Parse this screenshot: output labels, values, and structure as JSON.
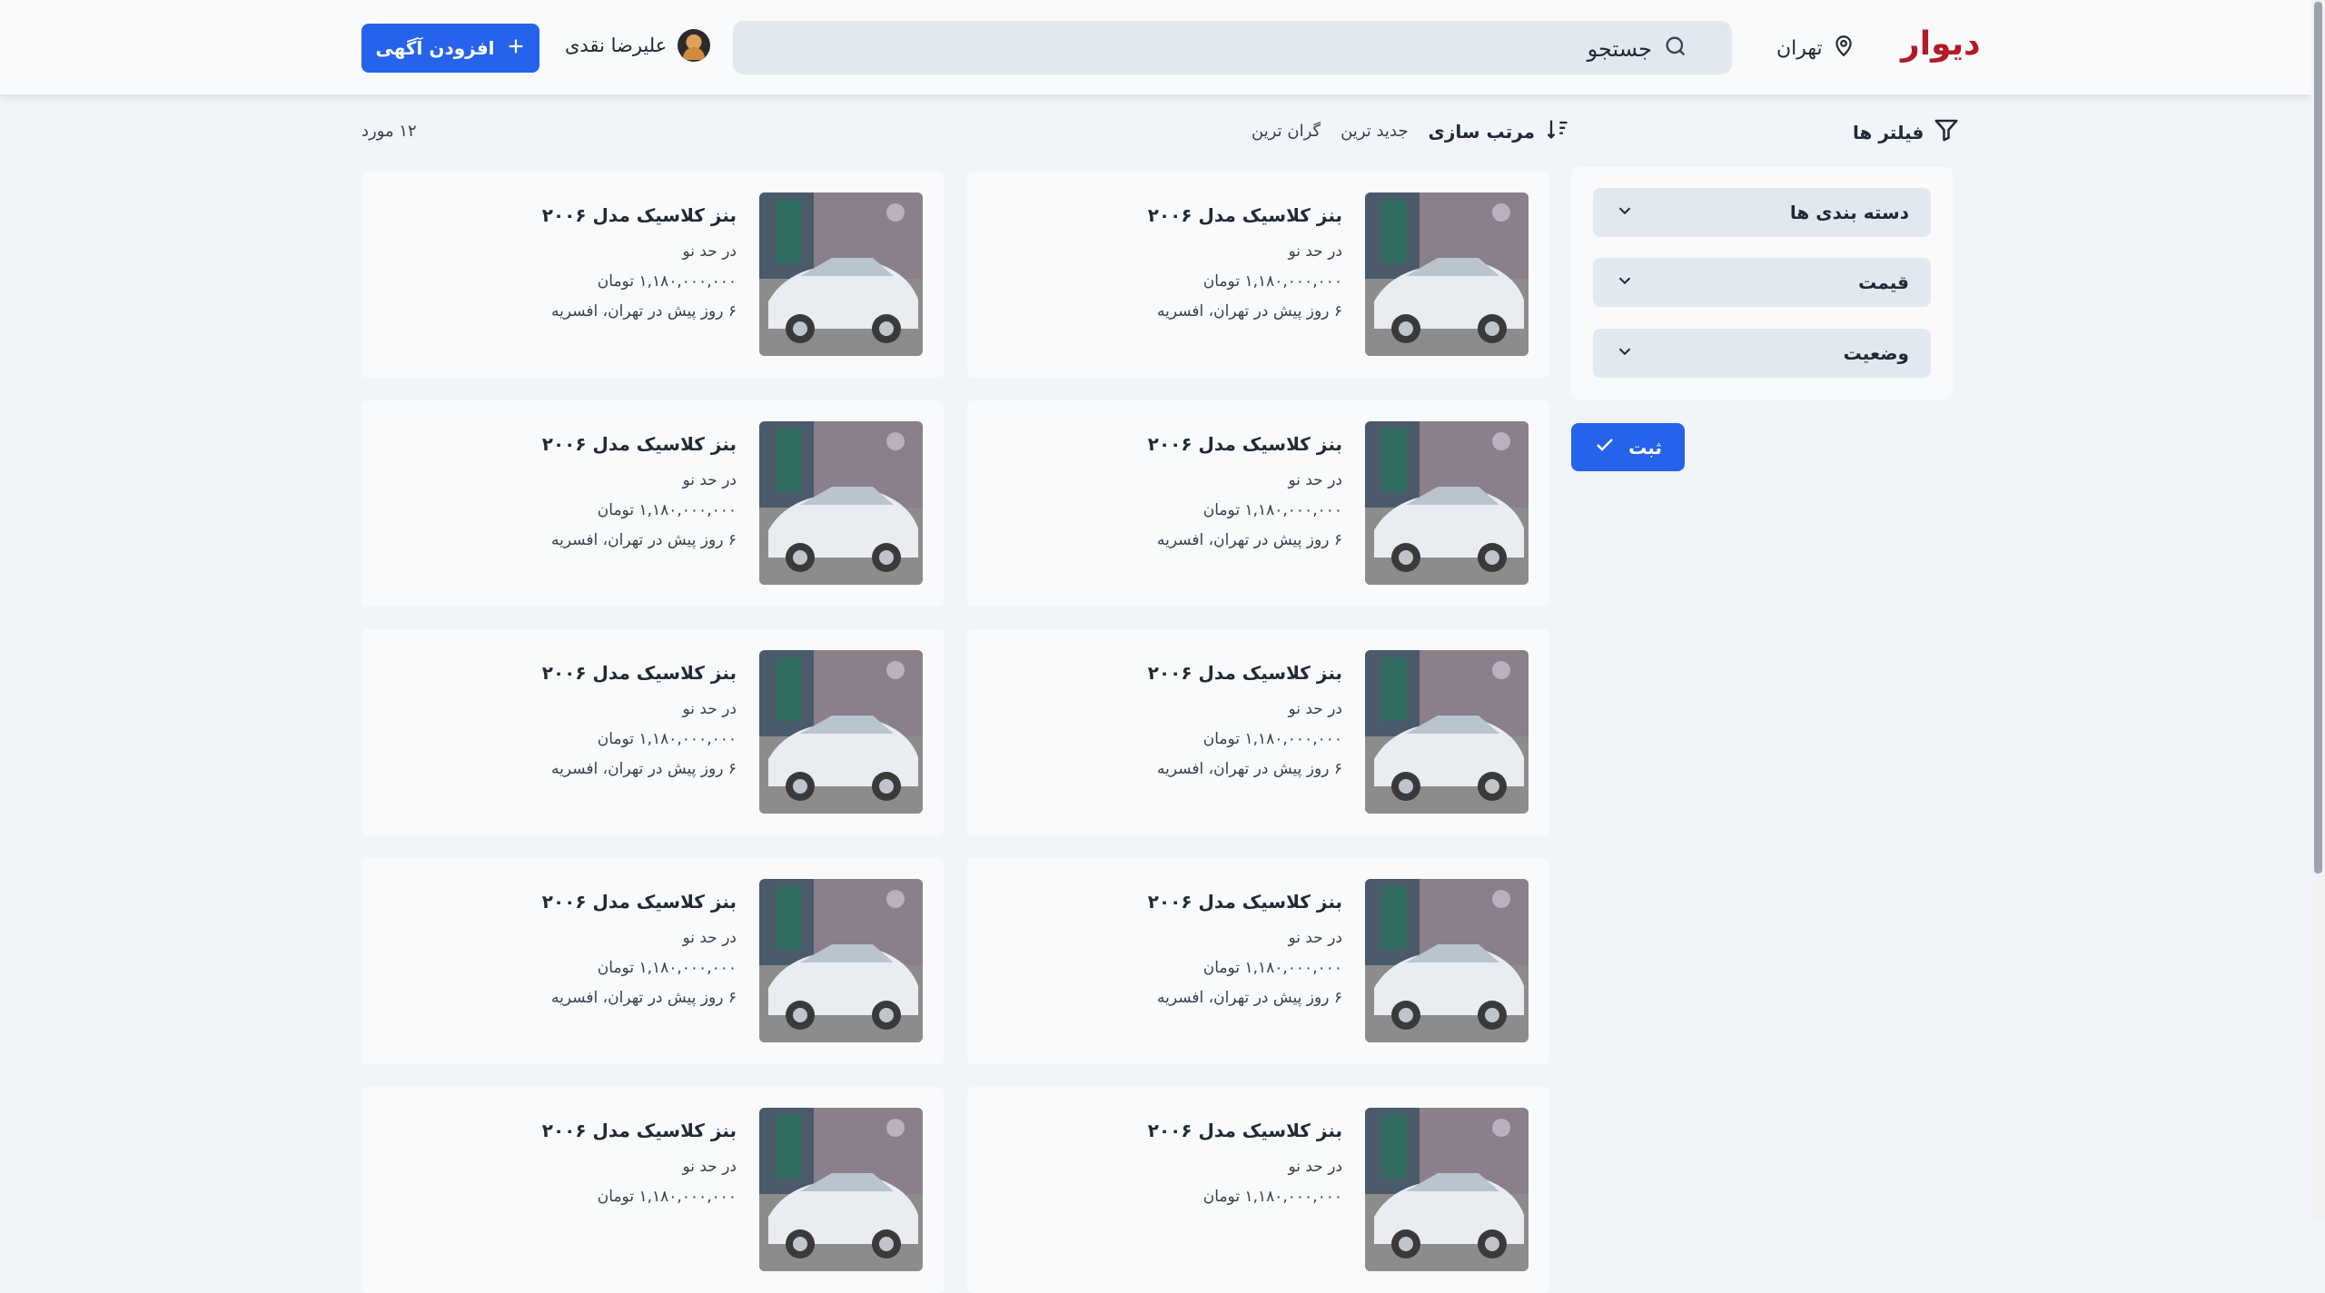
{
  "header": {
    "logo": "دیوار",
    "city": "تهران",
    "search_placeholder": "جستجو",
    "user_name": "علیرضا نقدی",
    "add_button": "افزودن آگهی"
  },
  "sidebar": {
    "title": "فیلتر ها",
    "filters": [
      {
        "label": "دسته بندی ها"
      },
      {
        "label": "قیمت"
      },
      {
        "label": "وضعیت"
      }
    ],
    "submit_button": "ثبت"
  },
  "toolbar": {
    "sort_label": "مرتب سازی",
    "sort_options": [
      "جدید ترین",
      "گران ترین"
    ],
    "count": "۱۲ مورد"
  },
  "listings": [
    {
      "title": "بنز کلاسیک مدل ۲۰۰۶",
      "condition": "در حد نو",
      "price": "۱,۱۸۰,۰۰۰,۰۰۰ تومان",
      "time_location": "۶ روز پیش در تهران، افسریه"
    },
    {
      "title": "بنز کلاسیک مدل ۲۰۰۶",
      "condition": "در حد نو",
      "price": "۱,۱۸۰,۰۰۰,۰۰۰ تومان",
      "time_location": "۶ روز پیش در تهران، افسریه"
    },
    {
      "title": "بنز کلاسیک مدل ۲۰۰۶",
      "condition": "در حد نو",
      "price": "۱,۱۸۰,۰۰۰,۰۰۰ تومان",
      "time_location": "۶ روز پیش در تهران، افسریه"
    },
    {
      "title": "بنز کلاسیک مدل ۲۰۰۶",
      "condition": "در حد نو",
      "price": "۱,۱۸۰,۰۰۰,۰۰۰ تومان",
      "time_location": "۶ روز پیش در تهران، افسریه"
    },
    {
      "title": "بنز کلاسیک مدل ۲۰۰۶",
      "condition": "در حد نو",
      "price": "۱,۱۸۰,۰۰۰,۰۰۰ تومان",
      "time_location": "۶ روز پیش در تهران، افسریه"
    },
    {
      "title": "بنز کلاسیک مدل ۲۰۰۶",
      "condition": "در حد نو",
      "price": "۱,۱۸۰,۰۰۰,۰۰۰ تومان",
      "time_location": "۶ روز پیش در تهران، افسریه"
    },
    {
      "title": "بنز کلاسیک مدل ۲۰۰۶",
      "condition": "در حد نو",
      "price": "۱,۱۸۰,۰۰۰,۰۰۰ تومان",
      "time_location": "۶ روز پیش در تهران، افسریه"
    },
    {
      "title": "بنز کلاسیک مدل ۲۰۰۶",
      "condition": "در حد نو",
      "price": "۱,۱۸۰,۰۰۰,۰۰۰ تومان",
      "time_location": "۶ روز پیش در تهران، افسریه"
    },
    {
      "title": "بنز کلاسیک مدل ۲۰۰۶",
      "condition": "در حد نو",
      "price": "۱,۱۸۰,۰۰۰,۰۰۰ تومان",
      "time_location": ""
    },
    {
      "title": "بنز کلاسیک مدل ۲۰۰۶",
      "condition": "در حد نو",
      "price": "۱,۱۸۰,۰۰۰,۰۰۰ تومان",
      "time_location": ""
    }
  ],
  "colors": {
    "brand": "#b31a25",
    "primary": "#2563eb",
    "background": "#f1f5f9"
  }
}
